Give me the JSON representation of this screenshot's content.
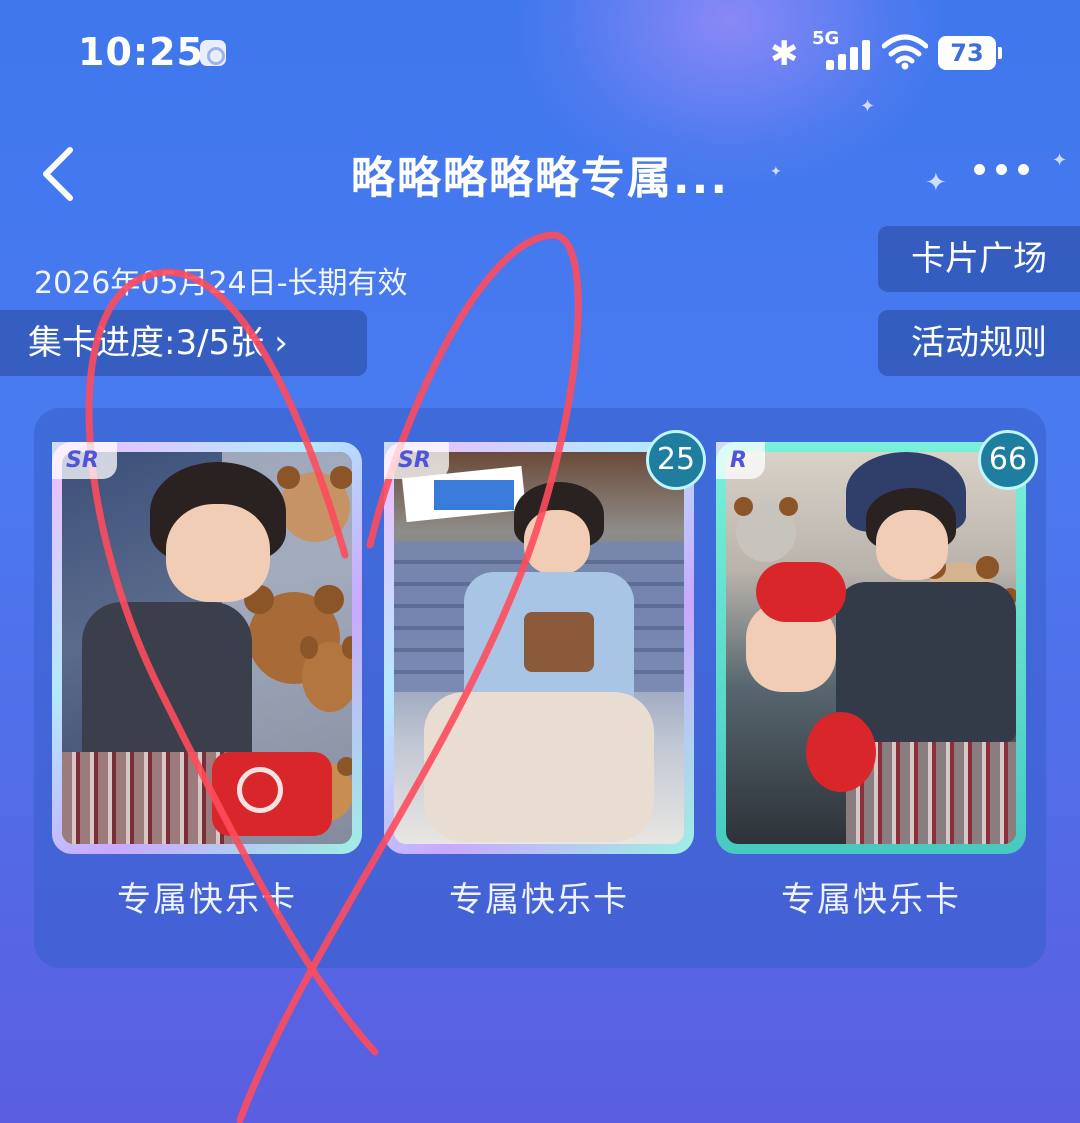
{
  "status_bar": {
    "time": "10:25",
    "network_label": "5G",
    "battery": "73",
    "icons": [
      "app-notification-icon",
      "bluetooth-icon",
      "signal-icon",
      "wifi-icon",
      "battery-icon"
    ]
  },
  "header": {
    "title": "略略略略略专属...",
    "back_icon": "chevron-left-icon",
    "more_icon": "more-horizontal-icon"
  },
  "validity": "2026年05月24日-长期有效",
  "progress": {
    "label": "集卡进度:3/5张",
    "chevron": "›"
  },
  "side_buttons": {
    "square": "卡片广场",
    "rules": "活动规则"
  },
  "cards": [
    {
      "rarity": "SR",
      "name": "专属快乐卡",
      "count": ""
    },
    {
      "rarity": "SR",
      "name": "专属快乐卡",
      "count": "25"
    },
    {
      "rarity": "R",
      "name": "专属快乐卡",
      "count": "66"
    }
  ],
  "colors": {
    "background_top": "#3f77ec",
    "background_bottom": "#5a5ee0",
    "pill_bg": "#3056b2",
    "scribble": "#ff4b5c",
    "badge": "#1f7ea0"
  }
}
